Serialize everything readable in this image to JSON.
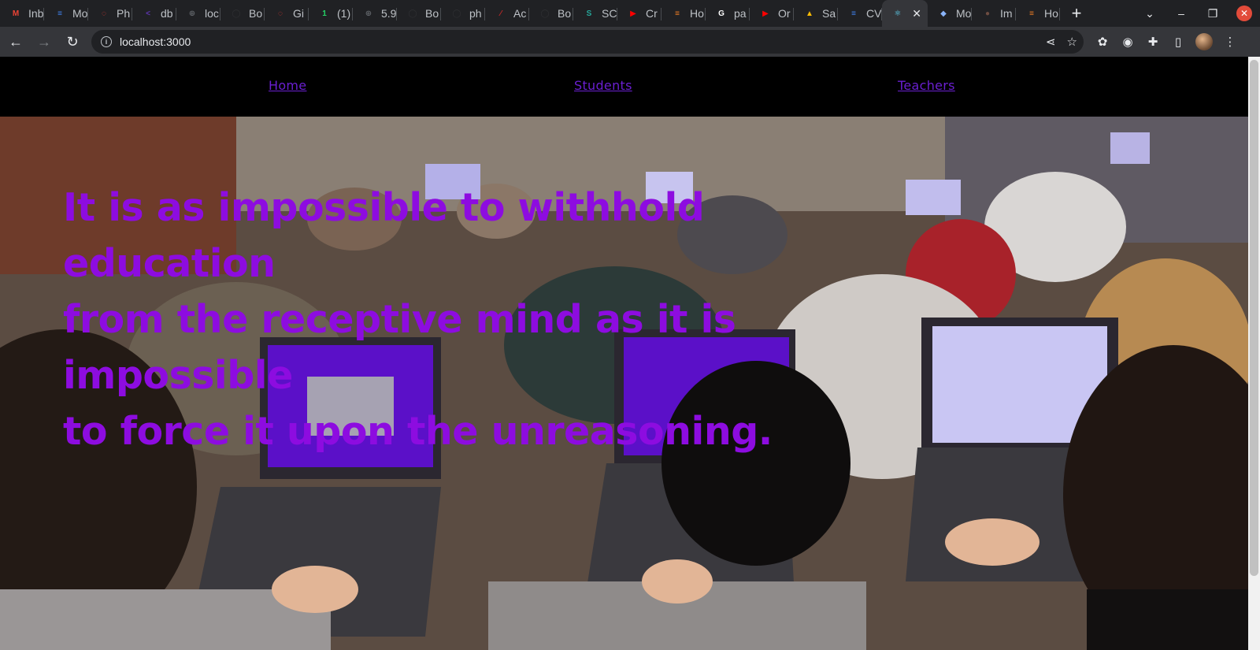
{
  "browser": {
    "tabs": [
      {
        "title": "Inb",
        "icon": "gmail-icon",
        "color": "#ea4335",
        "glyph": "M"
      },
      {
        "title": "Mo",
        "icon": "docs-icon",
        "color": "#4285f4",
        "glyph": "≡"
      },
      {
        "title": "Ph",
        "icon": "spinner-icon",
        "color": "#e53935",
        "glyph": "◌"
      },
      {
        "title": "db",
        "icon": "share-icon",
        "color": "#5e35b1",
        "glyph": "<"
      },
      {
        "title": "loc",
        "icon": "globe-icon",
        "color": "#5f6368",
        "glyph": "⊕"
      },
      {
        "title": "Bo",
        "icon": "github-icon",
        "color": "#303134",
        "glyph": "◯"
      },
      {
        "title": "Gi",
        "icon": "spinner-icon",
        "color": "#e53935",
        "glyph": "◌"
      },
      {
        "title": "(1)",
        "icon": "whatsapp-icon",
        "color": "#25d366",
        "glyph": "1"
      },
      {
        "title": "5.9",
        "icon": "globe-icon",
        "color": "#5f6368",
        "glyph": "⊕"
      },
      {
        "title": "Bo",
        "icon": "github-icon",
        "color": "#303134",
        "glyph": "◯"
      },
      {
        "title": "ph",
        "icon": "github-icon",
        "color": "#303134",
        "glyph": "◯"
      },
      {
        "title": "Ac",
        "icon": "bolt-icon",
        "color": "#c62828",
        "glyph": "⁄"
      },
      {
        "title": "Bo",
        "icon": "github-icon",
        "color": "#303134",
        "glyph": "◯"
      },
      {
        "title": "SC",
        "icon": "sc-icon",
        "color": "#26a69a",
        "glyph": "S"
      },
      {
        "title": "Cr",
        "icon": "youtube-icon",
        "color": "#ff0000",
        "glyph": "▶"
      },
      {
        "title": "Ho",
        "icon": "stackoverflow-icon",
        "color": "#f48024",
        "glyph": "≡"
      },
      {
        "title": "pa",
        "icon": "google-icon",
        "color": "#ffffff",
        "glyph": "G"
      },
      {
        "title": "Or",
        "icon": "youtube-icon",
        "color": "#ff0000",
        "glyph": "▶"
      },
      {
        "title": "Sa",
        "icon": "drive-icon",
        "color": "#fbbc04",
        "glyph": "▲"
      },
      {
        "title": "CV",
        "icon": "docs-icon",
        "color": "#4285f4",
        "glyph": "≡"
      },
      {
        "title": "",
        "icon": "react-icon",
        "color": "#61dafb",
        "glyph": "⚛",
        "active": true
      },
      {
        "title": "Mo",
        "icon": "eraser-icon",
        "color": "#8ab4f8",
        "glyph": "◆"
      },
      {
        "title": "Im",
        "icon": "person-icon",
        "color": "#6d4c41",
        "glyph": "●"
      },
      {
        "title": "Ho",
        "icon": "stackoverflow-icon",
        "color": "#f48024",
        "glyph": "≡"
      }
    ],
    "url": "localhost:3000"
  },
  "nav": {
    "home": "Home",
    "students": "Students",
    "teachers": "Teachers"
  },
  "hero": {
    "quote_line1": "It is as impossible to withhold education",
    "quote_line2": "from the receptive mind as it is impossible",
    "quote_line3": "to force it upon the unreasoning."
  },
  "colors": {
    "link": "#6a1fd1",
    "quote": "#8d0ce0",
    "navbar_bg": "#000000"
  }
}
